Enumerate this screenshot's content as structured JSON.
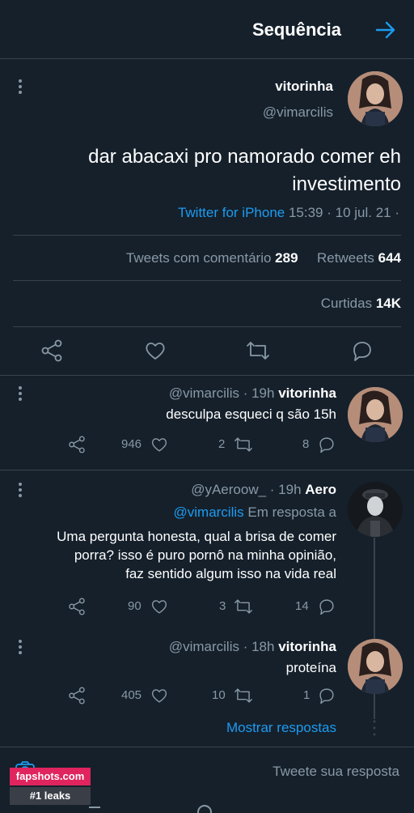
{
  "header": {
    "title": "Sequência"
  },
  "main_tweet": {
    "name": "vitorinha",
    "handle": "@vimarcilis",
    "text_line1": "dar abacaxi pro namorado comer eh",
    "text_line2": "investimento",
    "meta_time": "15:39 · 10 jul. 21 ·",
    "meta_source": "Twitter for iPhone",
    "retweets_count": "644",
    "retweets_label": "Retweets",
    "quotes_count": "289",
    "quotes_label": "Tweets com comentário",
    "likes_count": "14K",
    "likes_label": "Curtidas"
  },
  "replies": [
    {
      "name": "vitorinha",
      "meta": "@vimarcilis · 19h",
      "text": "desculpa esqueci q são 15h",
      "replies": "8",
      "retweets": "2",
      "likes": "946"
    },
    {
      "name": "Aero",
      "meta": "@yAeroow_ · 19h",
      "reply_to_prefix": "Em resposta a",
      "reply_to_handle": "@vimarcilis",
      "text_line1": "Uma pergunta honesta, qual a brisa de comer",
      "text_line2": "porra? isso é puro pornô na minha opinião,",
      "text_line3": "faz sentido algum isso na vida real",
      "replies": "14",
      "retweets": "3",
      "likes": "90"
    },
    {
      "name": "vitorinha",
      "meta": "@vimarcilis · 18h",
      "text": "proteína",
      "replies": "1",
      "retweets": "10",
      "likes": "405"
    }
  ],
  "show_replies": "Mostrar respostas",
  "compose": {
    "placeholder": "Tweete sua resposta"
  },
  "watermark": {
    "site": "fapshots.com",
    "tagline": "#1 leaks"
  },
  "colors": {
    "background": "#15202b",
    "accent": "#1d9bf0",
    "muted": "#8899a6",
    "divider": "#38444d"
  }
}
